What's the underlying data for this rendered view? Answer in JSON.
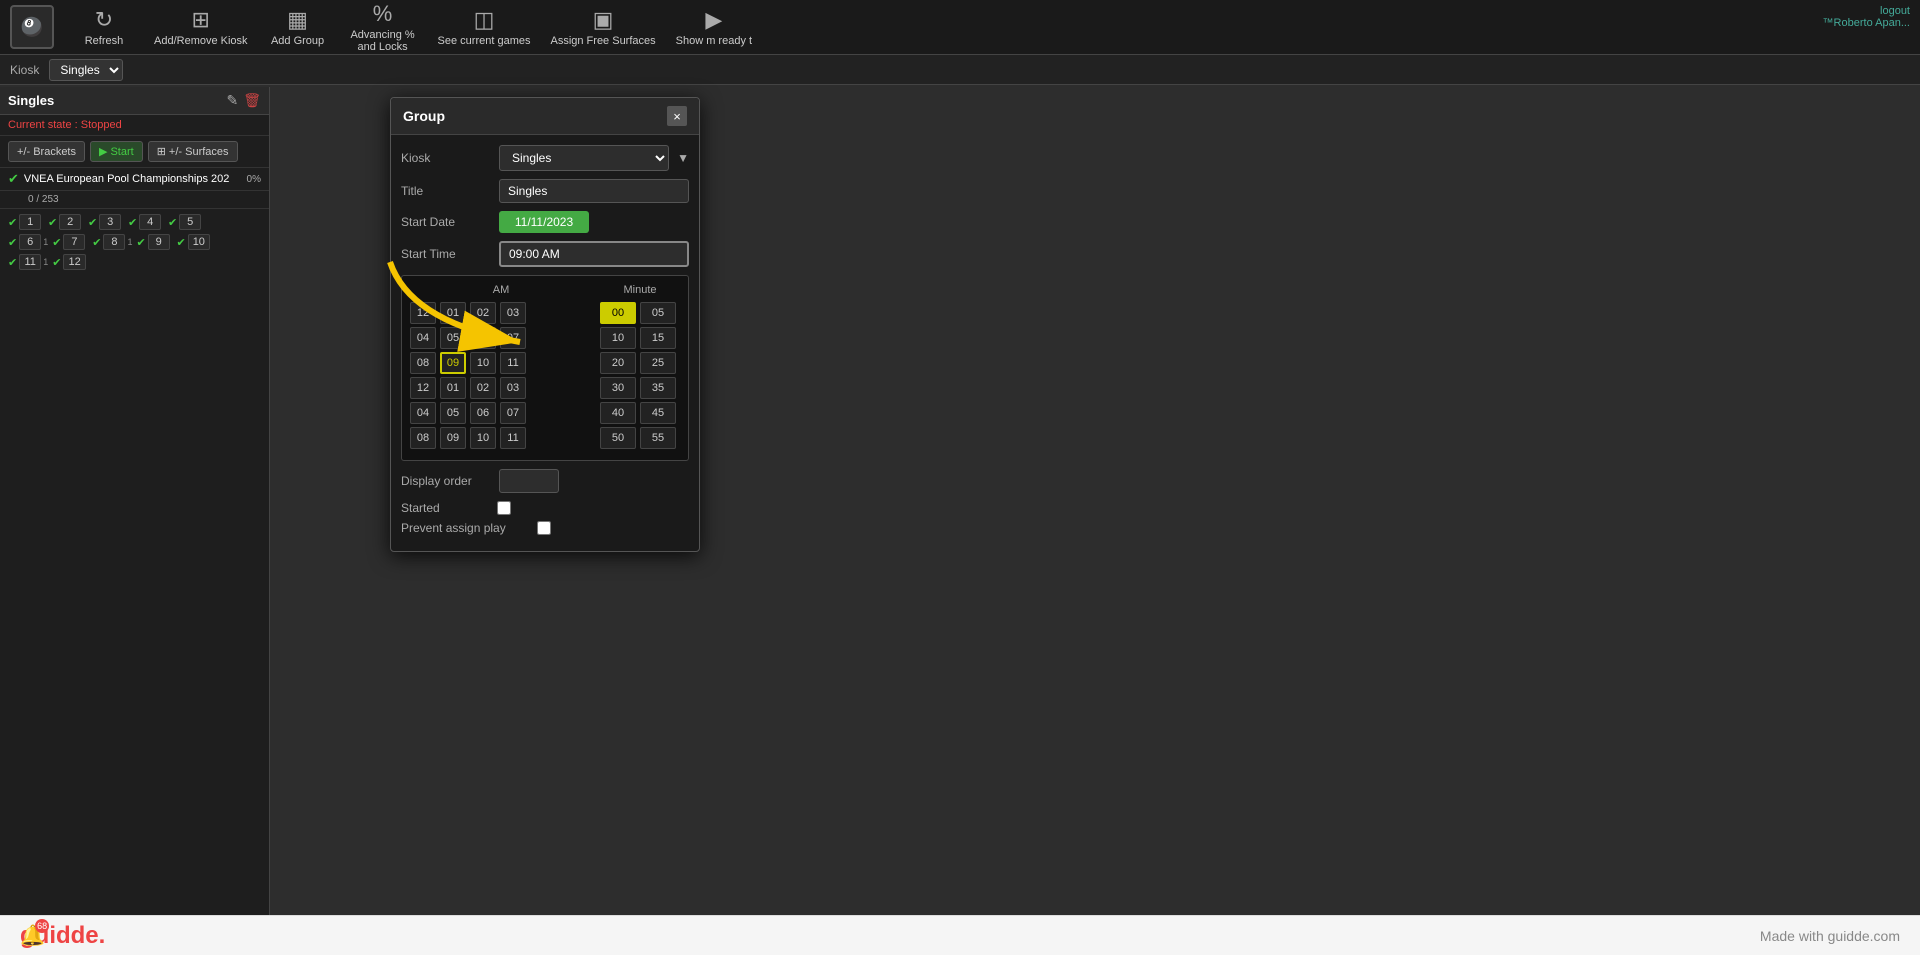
{
  "toolbar": {
    "logo_text": "🎱",
    "buttons": [
      {
        "id": "refresh",
        "icon": "↻",
        "label": "Refresh"
      },
      {
        "id": "add-remove-kiosk",
        "icon": "⊞",
        "label": "Add/Remove Kiosk"
      },
      {
        "id": "add-group",
        "icon": "▦",
        "label": "Add Group"
      },
      {
        "id": "advancing-locks",
        "icon": "%",
        "label": "Advancing % and Locks"
      },
      {
        "id": "see-current-games",
        "icon": "◫",
        "label": "See current games"
      },
      {
        "id": "assign-free-surfaces",
        "icon": "▣",
        "label": "Assign Free Surfaces"
      },
      {
        "id": "show-ready",
        "icon": "▶",
        "label": "Show m ready t"
      }
    ]
  },
  "kiosk_bar": {
    "label": "Kiosk",
    "selected": "Singles"
  },
  "sidebar": {
    "title": "Singles",
    "current_state_label": "Current state :",
    "current_state_value": "Stopped",
    "brackets_btn": "+/- Brackets",
    "start_btn": "Start",
    "surfaces_btn": "+/- Surfaces",
    "event_name": "VNEA European Pool Championships 202",
    "event_progress_pct": "0%",
    "event_progress": "0 / 253",
    "bracket_items": [
      {
        "num": 1,
        "sub": ""
      },
      {
        "num": 2,
        "sub": ""
      },
      {
        "num": 3,
        "sub": ""
      },
      {
        "num": 4,
        "sub": ""
      },
      {
        "num": 5,
        "sub": ""
      },
      {
        "num": 6,
        "sub": "1"
      },
      {
        "num": 7,
        "sub": ""
      },
      {
        "num": 8,
        "sub": "1"
      },
      {
        "num": 9,
        "sub": ""
      },
      {
        "num": 10,
        "sub": ""
      },
      {
        "num": 11,
        "sub": "1"
      },
      {
        "num": 12,
        "sub": ""
      }
    ]
  },
  "modal": {
    "title": "Group",
    "close_label": "×",
    "fields": {
      "kiosk_label": "Kiosk",
      "kiosk_value": "Singles",
      "title_label": "Title",
      "title_value": "Singles",
      "start_date_label": "Start Date",
      "start_date_value": "11/11/2023",
      "start_time_label": "Start Time",
      "start_time_value": "09:00 AM",
      "display_order_label": "Display order",
      "started_label": "Started",
      "prevent_assign_label": "Prevent assign play"
    },
    "time_picker": {
      "am_label": "AM",
      "minute_label": "Minute",
      "hours_row1": [
        "12",
        "01",
        "02",
        "03"
      ],
      "hours_row2": [
        "04",
        "05",
        "06",
        "07"
      ],
      "hours_row3": [
        "08",
        "09",
        "10",
        "11"
      ],
      "hours_row4": [
        "12",
        "01",
        "02",
        "03"
      ],
      "hours_row5": [
        "04",
        "05",
        "06",
        "07"
      ],
      "hours_row6": [
        "08",
        "09",
        "10",
        "11"
      ],
      "minutes_col": [
        "00",
        "05",
        "10",
        "15",
        "20",
        "25",
        "30",
        "35",
        "40",
        "45",
        "50",
        "55"
      ],
      "selected_hour": "09",
      "selected_minute": "00"
    }
  },
  "bottom_bar": {
    "logo": "guidde.",
    "made_with": "Made with guidde.com"
  },
  "top_right": {
    "logout_label": "logout",
    "user": "™Roberto Apan..."
  },
  "notification": {
    "badge": "68"
  }
}
